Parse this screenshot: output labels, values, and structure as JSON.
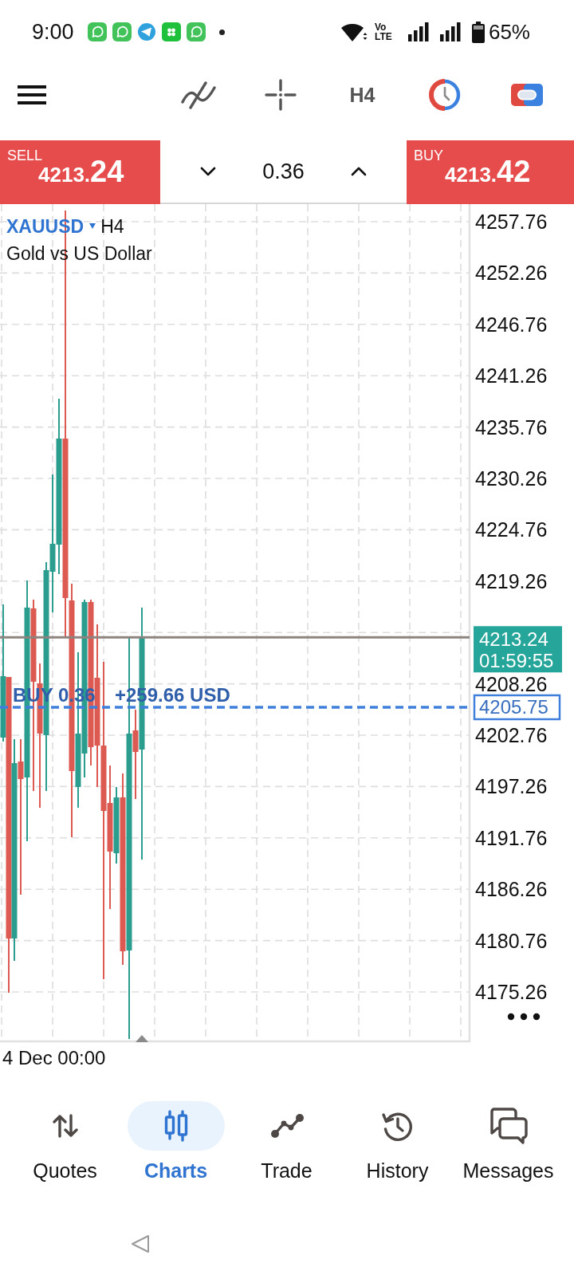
{
  "status_bar": {
    "time": "9:00",
    "network_label": "Vo LTE",
    "battery": "65%"
  },
  "toolbar": {
    "timeframe": "H4"
  },
  "trade_panel": {
    "sell": {
      "label": "SELL",
      "price": "4213.24"
    },
    "volume": "0.36",
    "buy": {
      "label": "BUY",
      "price": "4213.42"
    }
  },
  "chart": {
    "symbol": "XAUUSD",
    "timeframe": "H4",
    "description": "Gold vs US Dollar",
    "price_axis": [
      "4257.76",
      "4252.26",
      "4246.76",
      "4241.26",
      "4235.76",
      "4230.26",
      "4224.76",
      "4219.26",
      "4208.26",
      "4202.76",
      "4197.26",
      "4191.76",
      "4186.26",
      "4180.76",
      "4175.26"
    ],
    "current_price": {
      "price": "4213.24",
      "countdown": "01:59:55"
    },
    "position": {
      "label": "BUY 0.36",
      "profit": "+259.66 USD",
      "price": "4205.75"
    },
    "time_labels": [
      "4 Dec 00:00"
    ]
  },
  "bottom_nav": [
    {
      "label": "Quotes",
      "selected": false
    },
    {
      "label": "Charts",
      "selected": true
    },
    {
      "label": "Trade",
      "selected": false
    },
    {
      "label": "History",
      "selected": false
    },
    {
      "label": "Messages",
      "selected": false
    }
  ]
}
